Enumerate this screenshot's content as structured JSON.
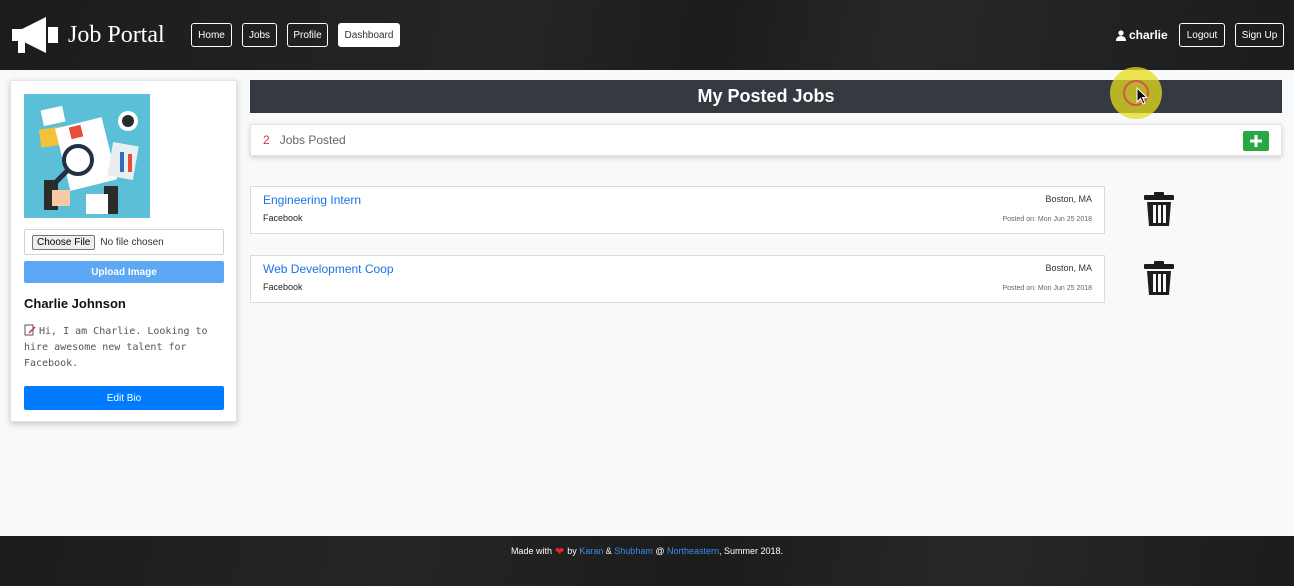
{
  "nav": {
    "brand": "Job Portal",
    "links": [
      "Home",
      "Jobs",
      "Profile",
      "Dashboard"
    ],
    "active": "Dashboard",
    "username": "charlie",
    "logout": "Logout",
    "signup": "Sign Up"
  },
  "sidebar": {
    "choose_file": "Choose File",
    "file_status": "No file chosen",
    "upload_label": "Upload Image",
    "name": "Charlie Johnson",
    "bio": "Hi, I am Charlie. Looking to hire awesome new talent for Facebook.",
    "edit_label": "Edit Bio"
  },
  "main": {
    "header": "My Posted Jobs",
    "jobs_count": "2",
    "jobs_count_label": "Jobs Posted",
    "jobs": [
      {
        "title": "Engineering Intern",
        "company": "Facebook",
        "location": "Boston, MA",
        "posted": "Posted on: Mon Jun 25 2018"
      },
      {
        "title": "Web Development Coop",
        "company": "Facebook",
        "location": "Boston, MA",
        "posted": "Posted on: Mon Jun 25 2018"
      }
    ]
  },
  "footer": {
    "made_with": "Made with",
    "by": "by",
    "author1": "Karan",
    "amp": "&",
    "author2": "Shubham",
    "at": "@",
    "school": "Northeastern",
    "suffix": ", Summer 2018."
  },
  "colors": {
    "navbar": "#1c1c1c",
    "header_bg": "#343a40",
    "link": "#1a73e8",
    "primary": "#007bff",
    "success": "#28a745",
    "count_red": "#dc3545"
  },
  "icons": {
    "brand": "megaphone-icon",
    "user": "user-icon",
    "add": "plus-icon",
    "delete": "trash-icon",
    "bio": "edit-icon"
  }
}
